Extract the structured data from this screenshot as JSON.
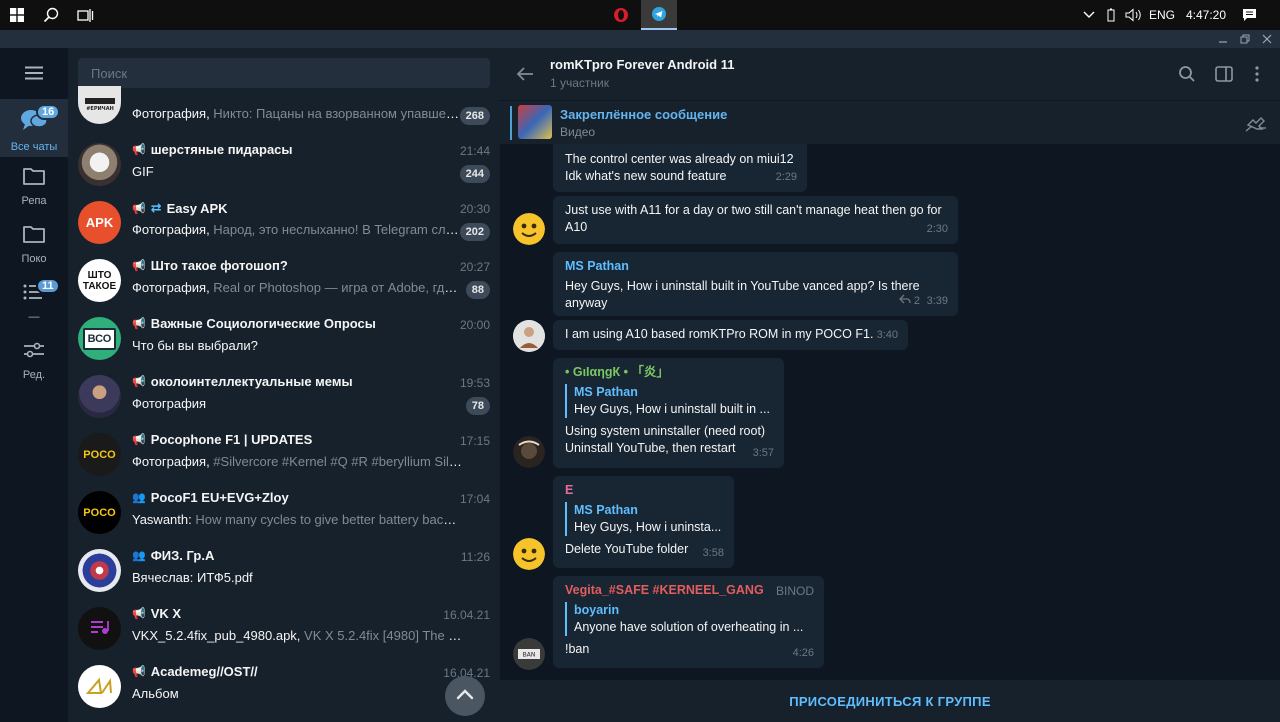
{
  "taskbar": {
    "tray": {
      "language": "ENG",
      "clock": "4:47:20"
    }
  },
  "folders": {
    "items": [
      {
        "label": "Все чаты",
        "badge": "16",
        "active": true
      },
      {
        "label": "Репа",
        "badge": ""
      },
      {
        "label": "Поко",
        "badge": ""
      },
      {
        "label": "—",
        "badge": "11"
      },
      {
        "label": "Ред.",
        "badge": ""
      }
    ]
  },
  "search": {
    "placeholder": "Поиск"
  },
  "chats": [
    {
      "title": "",
      "time": "",
      "preview_prefix": "Фотография, ",
      "preview_muted": "Никто: Пацаны на взорванном упавшем...",
      "badge": "268"
    },
    {
      "title": "шерстяные пидарасы",
      "time": "21:44",
      "preview_prefix": "GIF",
      "preview_muted": "",
      "badge": "244"
    },
    {
      "title": "Easy APK",
      "time": "20:30",
      "preview_prefix": "Фотография, ",
      "preview_muted": "Народ, это неслыханно! В Telegram слил...",
      "badge": "202"
    },
    {
      "title": "Што такое фотошоп?",
      "time": "20:27",
      "preview_prefix": "Фотография, ",
      "preview_muted": "Real or Photoshop — игра от Adobe, где ва...",
      "badge": "88"
    },
    {
      "title": "Важные Социологические Опросы",
      "time": "20:00",
      "preview_prefix": "Что бы вы выбрали?",
      "preview_muted": "",
      "badge": ""
    },
    {
      "title": "околоинтеллектуальные мемы",
      "time": "19:53",
      "preview_prefix": "Фотография",
      "preview_muted": "",
      "badge": "78"
    },
    {
      "title": "Pocophone F1 | UPDATES",
      "time": "17:15",
      "preview_prefix": "Фотография, ",
      "preview_muted": "#Silvercore #Kernel #Q #R #beryllium  SilverCore...",
      "badge": ""
    },
    {
      "title": "PocoF1 EU+EVG+Zloy",
      "time": "17:04",
      "preview_prefix": "Yaswanth: ",
      "preview_muted": "How many cycles to give better battery backup",
      "badge": ""
    },
    {
      "title": "ФИЗ. Гр.А",
      "time": "11:26",
      "preview_prefix": "Вячеслав: ИТФ5.pdf",
      "preview_muted": "",
      "badge": ""
    },
    {
      "title": "VK X",
      "time": "16.04.21",
      "preview_prefix": "VKX_5.2.4fix_pub_4980.apk, ",
      "preview_muted": "VK X 5.2.4fix [4980] The Fixed Upda...",
      "badge": ""
    },
    {
      "title": "Academeg//OST//",
      "time": "16.04.21",
      "preview_prefix": "Альбом",
      "preview_muted": "",
      "badge": ""
    }
  ],
  "avatars": {
    "c2": "APK",
    "c3": "ШТО ТАКОЕ",
    "c4": "ВСО",
    "c6": "POCO",
    "c7": "POCO"
  },
  "header": {
    "title": "romKTpro Forever Android 11",
    "subtitle": "1 участник"
  },
  "pinned": {
    "title": "Закреплённое сообщение",
    "subtitle": "Видео"
  },
  "messages": [
    {
      "body": "The control center was already on miui12\nIdk what's new sound feature",
      "time": "2:29"
    },
    {
      "body": "Just use with A11 for a day or two still can't manage heat then go for A10",
      "time": "2:30"
    },
    {
      "sender": "MS Pathan",
      "body": "Hey Guys, How i uninstall built in YouTube vanced app? Is there anyway",
      "replies": "2",
      "time": "3:39"
    },
    {
      "body": "I am using A10 based romKTPro ROM in my POCO F1.",
      "time": "3:40"
    },
    {
      "sender": "• GιIαηgК • 「炎」",
      "reply_name": "MS Pathan",
      "reply_text": "Hey Guys, How i uninstall built in ...",
      "body": "Using system uninstaller  (need root)\nUninstall YouTube, then restart",
      "time": "3:57"
    },
    {
      "sender": "E",
      "reply_name": "MS Pathan",
      "reply_text": "Hey Guys, How i uninsta...",
      "body": "Delete YouTube folder",
      "time": "3:58"
    },
    {
      "sender": "Vegita_#SAFE #KERNEEL_GANG",
      "sender_tag": "BINOD",
      "reply_name": "boyarin",
      "reply_text": "Anyone have solution of overheating in ...",
      "body": "!ban",
      "time": "4:26"
    }
  ],
  "join": {
    "label": "ПРИСОЕДИНИТЬСЯ К ГРУППЕ"
  },
  "colors": {
    "accent": "#5ebeff",
    "sender_green": "#7bc862",
    "sender_pink": "#e56c9b",
    "sender_red": "#e35d5d"
  }
}
